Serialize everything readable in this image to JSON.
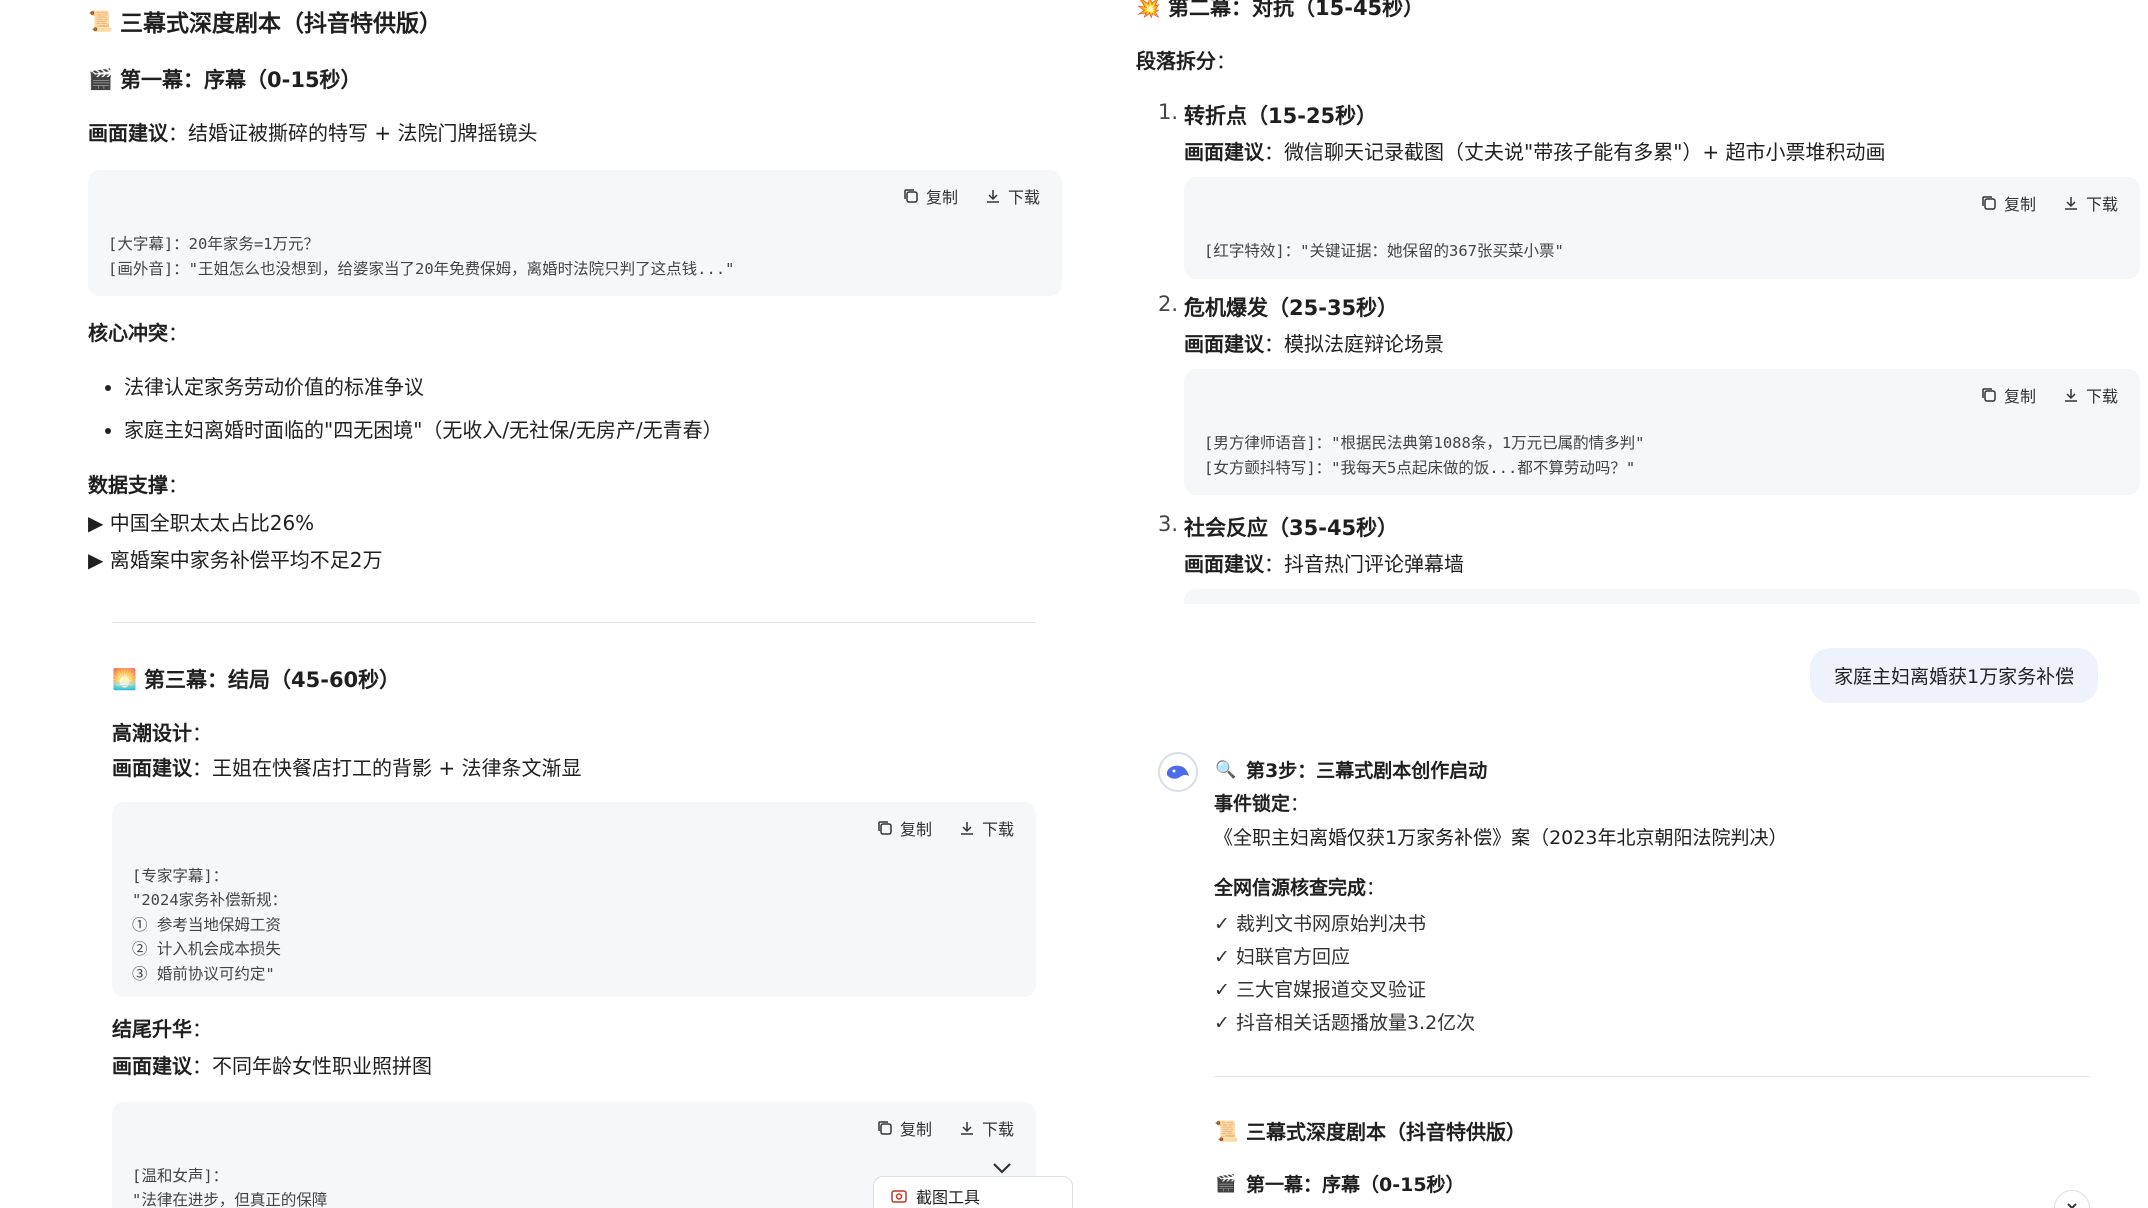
{
  "common": {
    "copy_label": "复制",
    "download_label": "下载"
  },
  "left_top": {
    "title_emoji": "📜",
    "title": "三幕式深度剧本（抖音特供版）",
    "act1_emoji": "🎬",
    "act1_title": "第一幕：序幕（0-15秒）",
    "visual_label": "画面建议",
    "visual_text": "：结婚证被撕碎的特写 + 法院门牌摇镜头",
    "code_lines": "[大字幕]：20年家务=1万元？\n[画外音]：\"王姐怎么也没想到，给婆家当了20年免费保姆，离婚时法院只判了这点钱...\"",
    "conflict_label": "核心冲突",
    "conflict_colon": "：",
    "conflict_items": [
      "法律认定家务劳动价值的标准争议",
      "家庭主妇离婚时面临的\"四无困境\"（无收入/无社保/无房产/无青春）"
    ],
    "data_label": "数据支撑",
    "data_colon": "：",
    "data_items": [
      "▶ 中国全职太太占比26%",
      "▶ 离婚案中家务补偿平均不足2万"
    ]
  },
  "left_bottom": {
    "act3_emoji": "🌅",
    "act3_title": "第三幕：结局（45-60秒）",
    "climax_label": "高潮设计",
    "colon": "：",
    "visual_label": "画面建议",
    "visual_text_1": "：王姐在快餐店打工的背影 + 法律条文渐显",
    "code1_lines": "[专家字幕]：\n\"2024家务补偿新规：\n① 参考当地保姆工资\n② 计入机会成本损失\n③ 婚前协议可约定\"",
    "ending_label": "结尾升华",
    "visual_text_2": "：不同年龄女性职业照拼图",
    "code2_lines": "[温和女声]：\n\"法律在进步，但真正的保障",
    "screenshot_tool_label": "截图工具"
  },
  "right_top": {
    "act2_emoji": "💥",
    "act2_title": "第二幕：对抗（15-45秒）",
    "section_label": "段落拆分",
    "section_colon": "：",
    "visual_label": "画面建议",
    "items": [
      {
        "num": "1.",
        "title": "转折点（15-25秒）",
        "visual_text": "：微信聊天记录截图（丈夫说\"带孩子能有多累\"）+ 超市小票堆积动画",
        "code": "[红字特效]：\"关键证据：她保留的367张买菜小票\""
      },
      {
        "num": "2.",
        "title": "危机爆发（25-35秒）",
        "visual_text": "：模拟法庭辩论场景",
        "code": "[男方律师语音]：\"根据民法典第1088条，1万元已属酌情多判\"\n[女方颤抖特写]：\"我每天5点起床做的饭...都不算劳动吗？\""
      },
      {
        "num": "3.",
        "title": "社会反应（35-45秒）",
        "visual_text": "：抖音热门评论弹幕墙",
        "code": ""
      }
    ]
  },
  "right_bottom": {
    "user_message": "家庭主妇离婚获1万家务补偿",
    "step_emoji": "🔍",
    "step_title": "第3步：三幕式剧本创作启动",
    "event_label": "事件锁定",
    "colon": "：",
    "event_text": "《全职主妇离婚仅获1万家务补偿》案（2023年北京朝阳法院判决）",
    "verify_label": "全网信源核查完成",
    "verify_items": [
      "✓ 裁判文书网原始判决书",
      "✓ 妇联官方回应",
      "✓ 三大官媒报道交叉验证",
      "✓ 抖音相关话题播放量3.2亿次"
    ],
    "script_title_emoji": "📜",
    "script_title": "三幕式深度剧本（抖音特供版）",
    "act1_emoji": "🎬",
    "act1_title": "第一幕：序幕（0-15秒）"
  }
}
